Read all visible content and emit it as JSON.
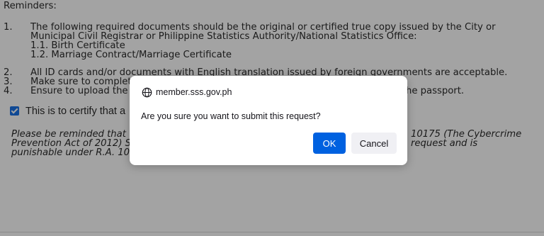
{
  "page": {
    "heading": "Reminders:",
    "items": [
      {
        "num": "1.",
        "text": "The following required documents should be the original or certified true copy issued by the City or"
      },
      {
        "num": "",
        "text": "Municipal Civil Registrar or Philippine Statistics Authority/National Statistics Office:"
      },
      {
        "num": "",
        "text": "1.1. Birth Certificate"
      },
      {
        "num": "",
        "text": "1.2. Marriage Contract/Marriage Certificate"
      },
      {
        "num": "2.",
        "text": "All ID cards and/or documents with English translation issued by foreign governments are acceptable."
      },
      {
        "num": "3.",
        "text": "Make sure to complet"
      },
      {
        "num": "4.",
        "text": "Ensure to upload the"
      }
    ],
    "item4_tail": "he passport.",
    "certify_text": "This is to certify that a",
    "certify_checked": true,
    "notice_left": [
      "Please be reminded that f",
      "Prevention Act of 2012) S",
      "punishable under R.A. 10"
    ],
    "notice_right": [
      "10175 (The Cybercrime",
      "request and is"
    ]
  },
  "dialog": {
    "origin": "member.sss.gov.ph",
    "origin_icon": "globe-icon",
    "message": "Are you sure you want to submit this request?",
    "ok_label": "OK",
    "cancel_label": "Cancel",
    "ok_color": "#0061e0",
    "cancel_color": "#f0f0f4"
  }
}
